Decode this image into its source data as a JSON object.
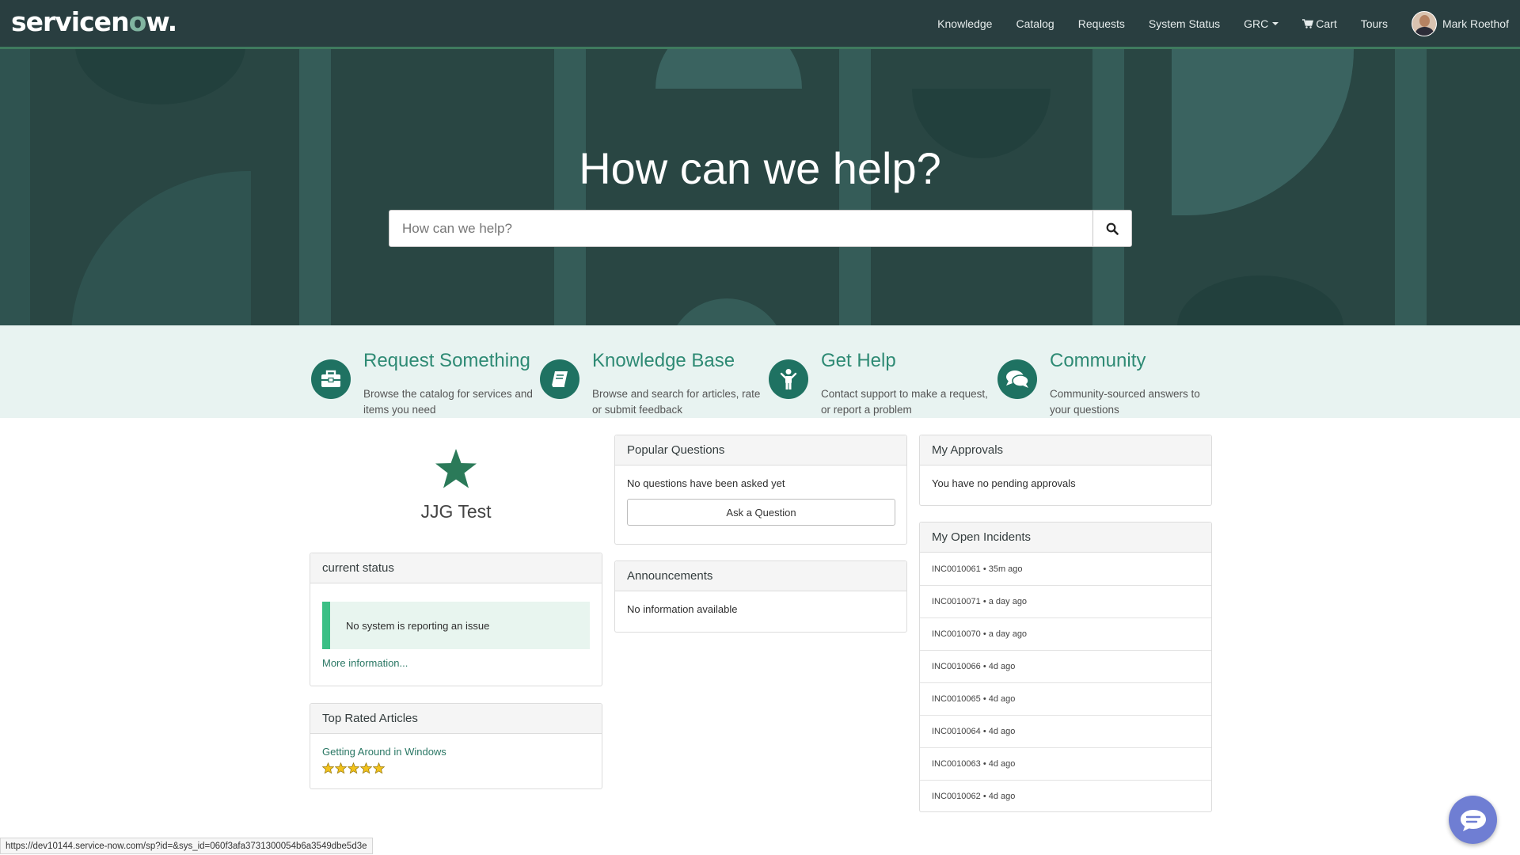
{
  "header": {
    "logo_text_pre": "servicen",
    "logo_text_o": "o",
    "logo_text_post": "w.",
    "nav": {
      "knowledge": "Knowledge",
      "catalog": "Catalog",
      "requests": "Requests",
      "system_status": "System Status",
      "grc": "GRC",
      "cart": "Cart",
      "tours": "Tours"
    },
    "user_name": "Mark Roethof"
  },
  "hero": {
    "title": "How can we help?",
    "search_placeholder": "How can we help?"
  },
  "quick_links": [
    {
      "title": "Request Something",
      "desc": "Browse the catalog for services and items you need",
      "icon": "briefcase-icon"
    },
    {
      "title": "Knowledge Base",
      "desc": "Browse and search for articles, rate or submit feedback",
      "icon": "book-icon"
    },
    {
      "title": "Get Help",
      "desc": "Contact support to make a request, or report a problem",
      "icon": "person-icon"
    },
    {
      "title": "Community",
      "desc": "Community-sourced answers to your questions",
      "icon": "chat-bubbles-icon"
    }
  ],
  "favorite": {
    "title": "JJG Test",
    "icon": "star-icon"
  },
  "current_status": {
    "title": "current status",
    "message": "No system is reporting an issue",
    "more_link": "More information..."
  },
  "top_rated": {
    "title": "Top Rated Articles",
    "article": "Getting Around in Windows",
    "rating": 5
  },
  "popular_questions": {
    "title": "Popular Questions",
    "empty": "No questions have been asked yet",
    "ask_button": "Ask a Question"
  },
  "announcements": {
    "title": "Announcements",
    "empty": "No information available"
  },
  "approvals": {
    "title": "My Approvals",
    "empty": "You have no pending approvals"
  },
  "incidents": {
    "title": "My Open Incidents",
    "items": [
      "INC0010061 • 35m ago",
      "INC0010071 • a day ago",
      "INC0010070 • a day ago",
      "INC0010066 • 4d ago",
      "INC0010065 • 4d ago",
      "INC0010064 • 4d ago",
      "INC0010063 • 4d ago",
      "INC0010062 • 4d ago"
    ]
  },
  "status_bar": {
    "url": "https://dev10144.service-now.com/sp?id=&sys_id=060f3afa3731300054b6a3549dbe5d3e"
  },
  "colors": {
    "nav_bg": "#293e40",
    "hero_bg": "#294643",
    "accent": "#2e8a74",
    "icon_circle": "#1f7262",
    "status_green": "#3bbf85",
    "chat_button": "#6f7ed3"
  }
}
